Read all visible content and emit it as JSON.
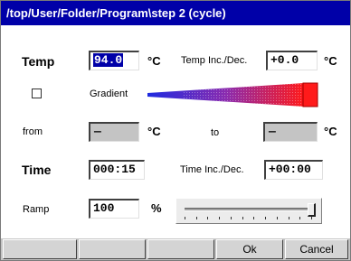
{
  "window": {
    "title": "/top/User/Folder/Program\\step 2 (cycle)"
  },
  "temp": {
    "label": "Temp",
    "value": "94.0",
    "unit": "°C",
    "inc_label": "Temp Inc./Dec.",
    "inc_value": "+0.0",
    "inc_unit": "°C"
  },
  "gradient": {
    "checked": false,
    "label": "Gradient",
    "colors": {
      "start": "#1e2be0",
      "mid": "#8a2cb0",
      "end": "#ff1a1a"
    }
  },
  "range": {
    "from_label": "from",
    "from_value": "—",
    "from_unit": "°C",
    "to_label": "to",
    "to_value": "—",
    "to_unit": "°C"
  },
  "time": {
    "label": "Time",
    "value": "000:15",
    "inc_label": "Time Inc./Dec.",
    "inc_value": "+00:00"
  },
  "ramp": {
    "label": "Ramp",
    "value": "100",
    "unit": "%",
    "slider_level_percent": 100
  },
  "buttons": {
    "blank_1": "",
    "blank_2": "",
    "blank_3": "",
    "ok": "Ok",
    "cancel": "Cancel"
  }
}
